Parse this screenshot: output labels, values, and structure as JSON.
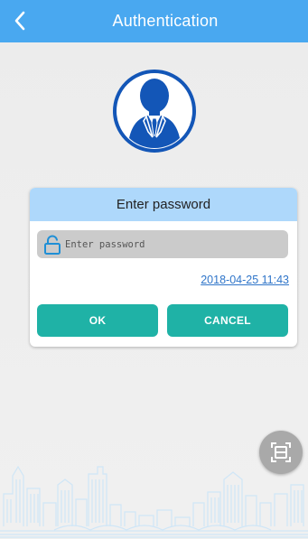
{
  "header": {
    "title": "Authentication",
    "back_icon": "back-chevron-icon"
  },
  "avatar": {
    "icon": "business-person-icon"
  },
  "dialog": {
    "title": "Enter password",
    "password": {
      "placeholder": "Enter password",
      "value": "",
      "icon": "unlock-icon"
    },
    "timestamp": "2018-04-25 11:43",
    "ok_label": "OK",
    "cancel_label": "CANCEL"
  },
  "fab": {
    "icon": "scan-icon"
  },
  "colors": {
    "header_bg": "#49a8f0",
    "dialog_header_bg": "#aed8fb",
    "button_bg": "#1fb2a6",
    "link": "#2f75c9",
    "avatar_blue": "#1356b7"
  }
}
